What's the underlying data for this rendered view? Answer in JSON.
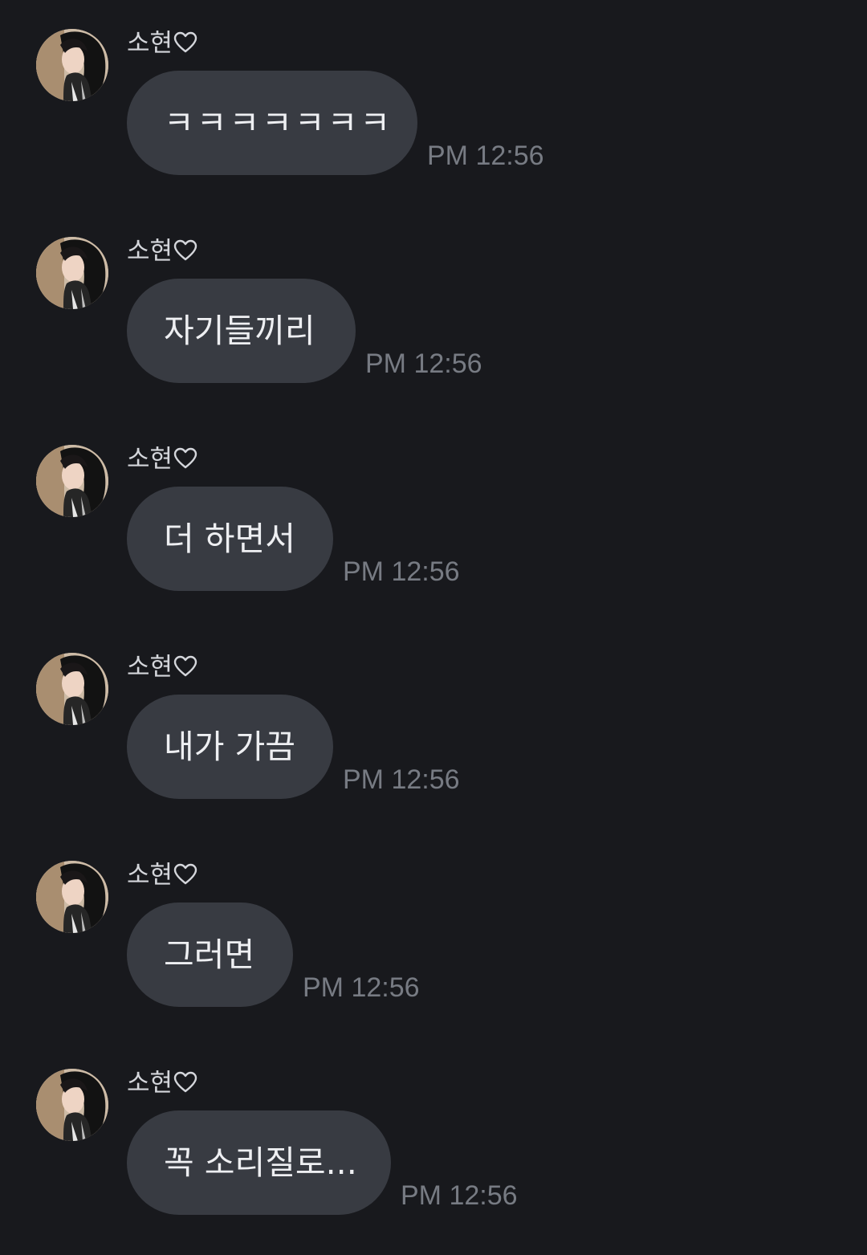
{
  "colors": {
    "background": "#18191d",
    "bubble": "#383b42",
    "bubble_text": "#eeeff2",
    "sender_text": "#d4d6db",
    "timestamp_text": "#777b83"
  },
  "messages": [
    {
      "sender": "소현",
      "text": "ㅋㅋㅋㅋㅋㅋㅋ",
      "time": "PM 12:56"
    },
    {
      "sender": "소현",
      "text": "자기들끼리",
      "time": "PM 12:56"
    },
    {
      "sender": "소현",
      "text": "더 하면서",
      "time": "PM 12:56"
    },
    {
      "sender": "소현",
      "text": "내가 가끔",
      "time": "PM 12:56"
    },
    {
      "sender": "소현",
      "text": "그러면",
      "time": "PM 12:56"
    },
    {
      "sender": "소현",
      "text": "꼭 소리질로...",
      "time": "PM 12:56"
    }
  ],
  "icons": {
    "sender_suffix": "heart-outline-icon",
    "avatar": "profile-photo"
  }
}
